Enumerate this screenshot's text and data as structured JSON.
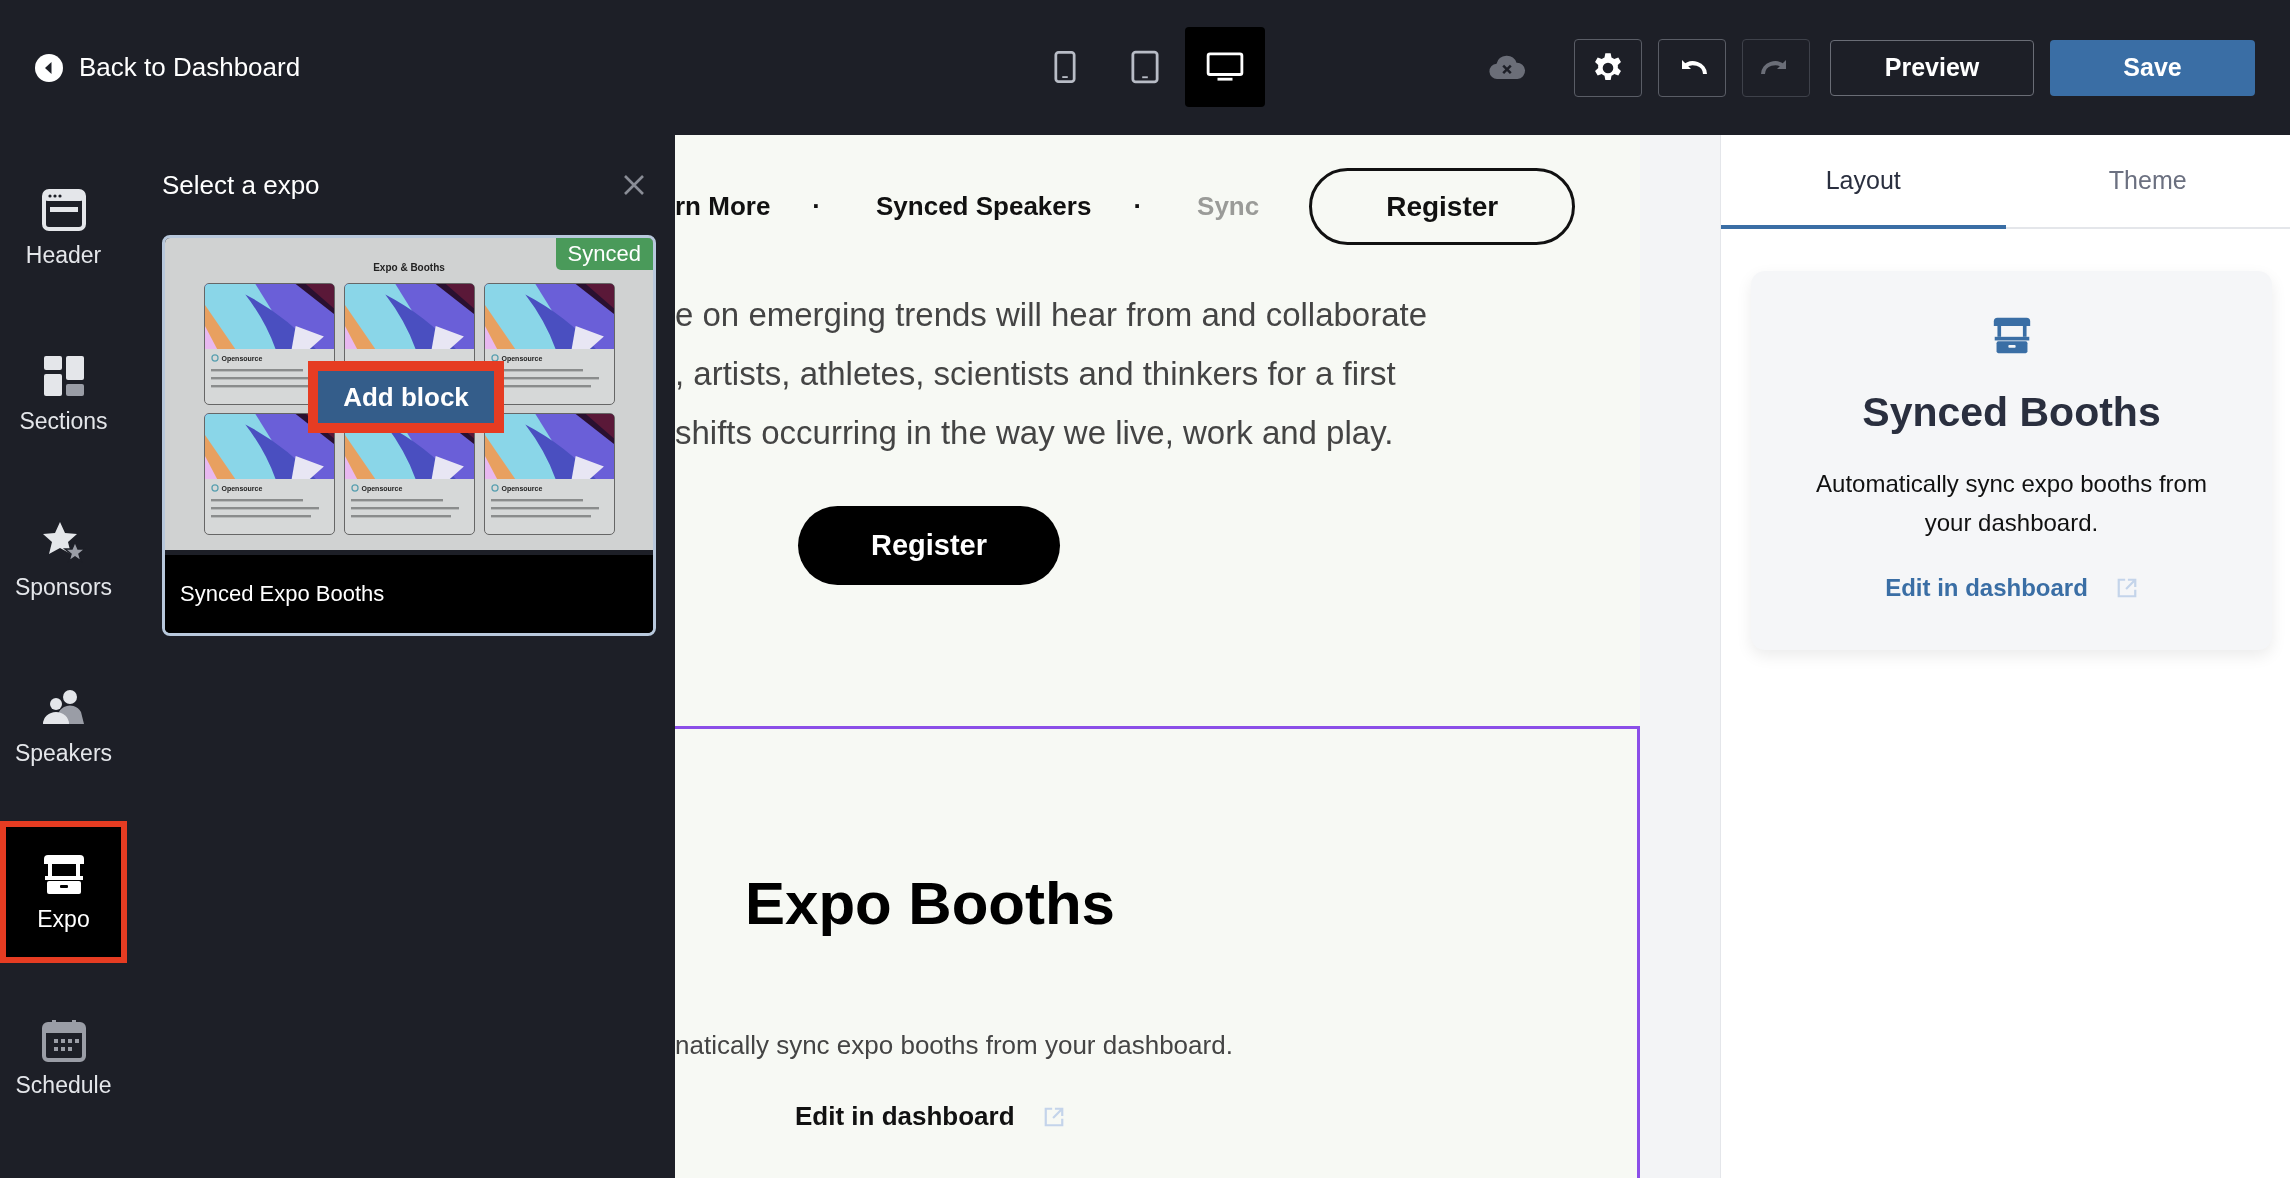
{
  "topbar": {
    "back_label": "Back to Dashboard",
    "devices": [
      {
        "kind": "phone",
        "selected": false
      },
      {
        "kind": "tablet",
        "selected": false
      },
      {
        "kind": "desktop",
        "selected": true
      }
    ],
    "tools": [
      {
        "kind": "settings",
        "disabled": false
      },
      {
        "kind": "undo",
        "disabled": false
      },
      {
        "kind": "redo",
        "disabled": true
      }
    ],
    "preview": "Preview",
    "save": "Save"
  },
  "rail": {
    "items": [
      {
        "kind": "header",
        "label": "Header",
        "selected": false
      },
      {
        "kind": "sections",
        "label": "Sections",
        "selected": false
      },
      {
        "kind": "sponsors",
        "label": "Sponsors",
        "selected": false
      },
      {
        "kind": "speakers",
        "label": "Speakers",
        "selected": false
      },
      {
        "kind": "expo",
        "label": "Expo",
        "selected": true
      },
      {
        "kind": "schedule",
        "label": "Schedule",
        "selected": false
      }
    ]
  },
  "panel": {
    "title": "Select a expo",
    "card": {
      "badge": "Synced",
      "caption": "Synced Expo Booths",
      "action": "Add block",
      "preview": {
        "heading": "Expo & Booths",
        "tiles": [
          {
            "kind": "card",
            "title": "Opensource"
          },
          {
            "kind": "picture"
          },
          {
            "kind": "card",
            "title": "Opensource"
          },
          {
            "kind": "card",
            "title": "Opensource"
          },
          {
            "kind": "card",
            "title": "Opensource"
          },
          {
            "kind": "card",
            "title": "Opensource"
          }
        ]
      }
    }
  },
  "canvas": {
    "nav": [
      {
        "kind": "link",
        "label": "rn More",
        "faded": false
      },
      {
        "kind": "dot",
        "label": "·"
      },
      {
        "kind": "link",
        "label": "Synced Speakers",
        "faded": false
      },
      {
        "kind": "dot",
        "label": "·"
      },
      {
        "kind": "link",
        "label": "Sync",
        "faded": true
      }
    ],
    "nav_button": "Register",
    "paragraph": [
      "e on emerging trends will hear from and collaborate",
      ", artists, athletes, scientists and thinkers for a first",
      " shifts occurring in the way we live, work and play."
    ],
    "register": "Register",
    "section": {
      "title": "Expo Booths",
      "text": "natically sync expo booths from your dashboard.",
      "link": "Edit in dashboard"
    }
  },
  "inspector": {
    "tabs": [
      {
        "label": "Layout",
        "selected": true
      },
      {
        "label": "Theme",
        "selected": false
      }
    ],
    "card": {
      "title": "Synced Booths",
      "text": "Automatically sync expo booths from your dashboard.",
      "link": "Edit in dashboard"
    }
  }
}
